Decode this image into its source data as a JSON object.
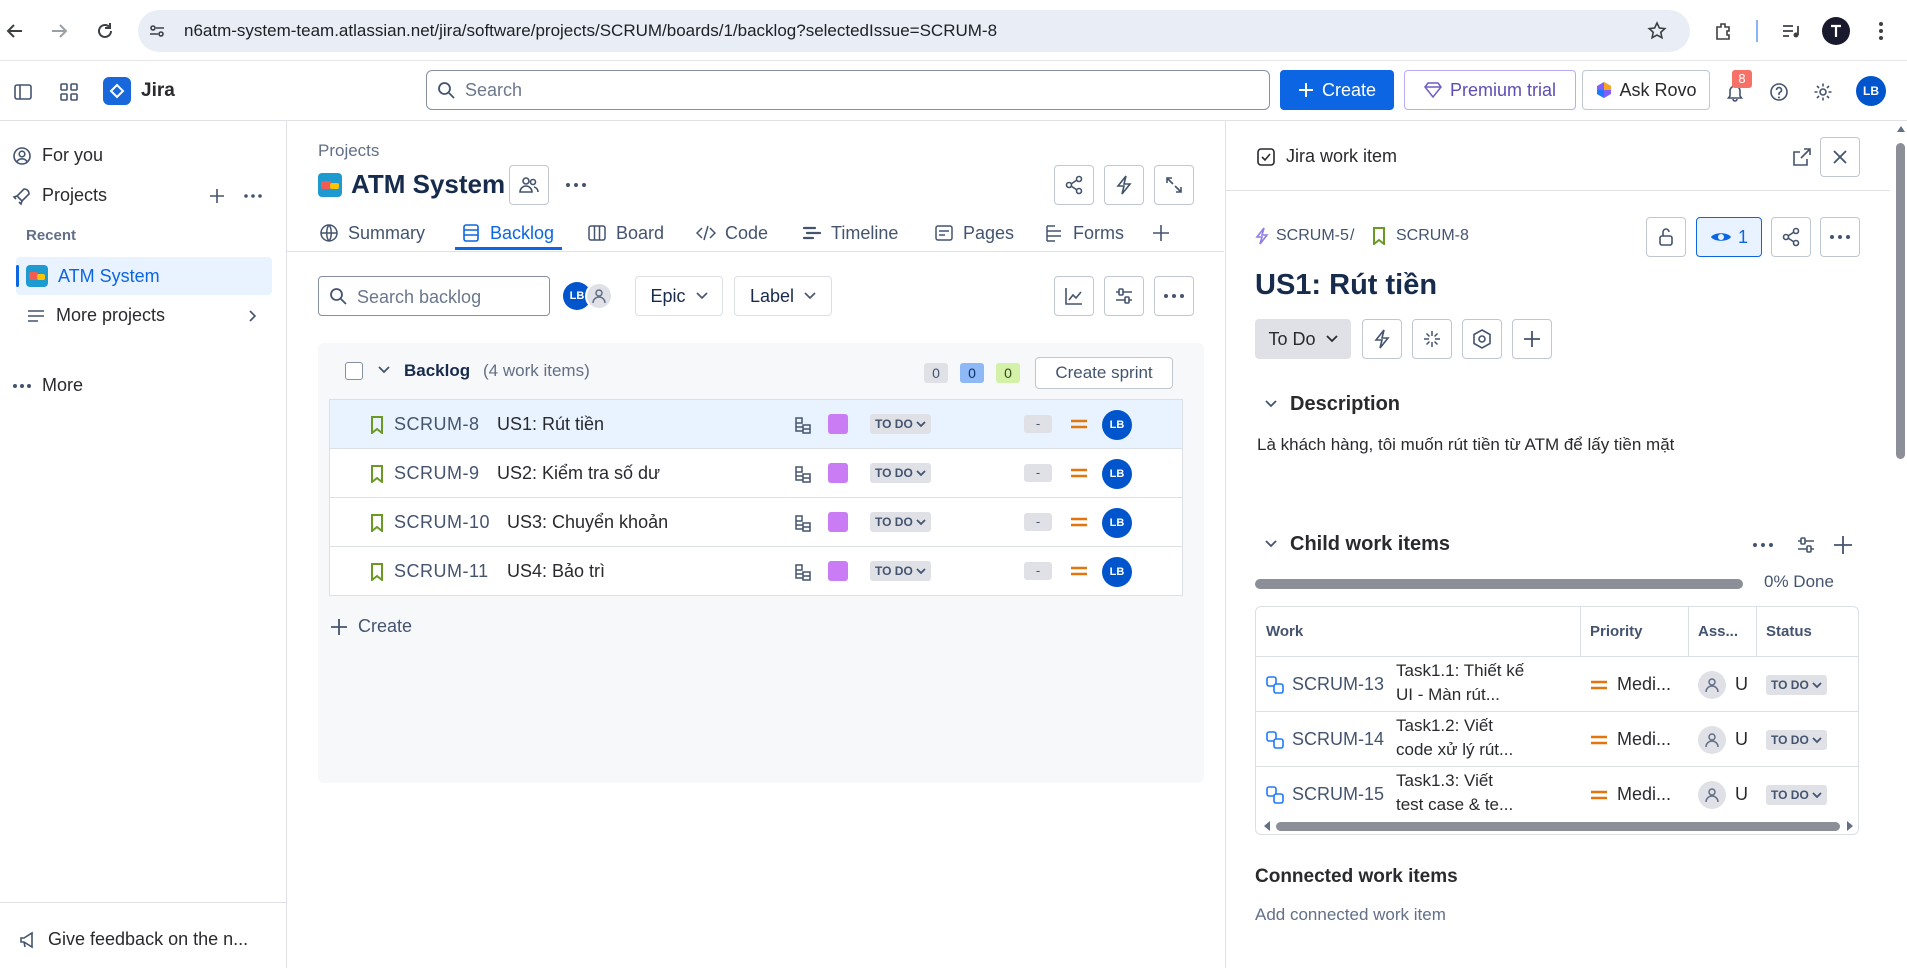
{
  "browser": {
    "url": "n6atm-system-team.atlassian.net/jira/software/projects/SCRUM/boards/1/backlog?selectedIssue=SCRUM-8"
  },
  "topnav": {
    "app_name": "Jira",
    "search_placeholder": "Search",
    "create_label": "Create",
    "premium_label": "Premium trial",
    "rovo_label": "Ask Rovo",
    "notif_count": "8",
    "user_initials": "LB"
  },
  "sidebar": {
    "for_you": "For you",
    "projects": "Projects",
    "recent_heading": "Recent",
    "recent_project": "ATM System",
    "more_projects": "More projects",
    "more": "More",
    "feedback": "Give feedback on the n..."
  },
  "project": {
    "breadcrumb": "Projects",
    "title": "ATM System",
    "tabs": [
      "Summary",
      "Backlog",
      "Board",
      "Code",
      "Timeline",
      "Pages",
      "Forms"
    ]
  },
  "backlog": {
    "search_placeholder": "Search backlog",
    "epic_filter": "Epic",
    "label_filter": "Label",
    "heading": "Backlog",
    "count": "(4 work items)",
    "counts": [
      "0",
      "0",
      "0"
    ],
    "create_sprint": "Create sprint",
    "create_label": "Create",
    "status_label": "TO DO",
    "points": "-",
    "assignee": "LB",
    "items": [
      {
        "key": "SCRUM-8",
        "summary": "US1: Rút tiền"
      },
      {
        "key": "SCRUM-9",
        "summary": "US2: Kiểm tra số dư"
      },
      {
        "key": "SCRUM-10",
        "summary": "US3: Chuyển khoản"
      },
      {
        "key": "SCRUM-11",
        "summary": "US4: Bảo trì"
      }
    ]
  },
  "detail": {
    "header": "Jira work item",
    "parent_key": "SCRUM-5",
    "separator": "/",
    "key": "SCRUM-8",
    "watch_count": "1",
    "title": "US1: Rút tiền",
    "status": "To Do",
    "description_heading": "Description",
    "description": "Là khách hàng, tôi muốn rút tiền từ ATM để lấy tiền mặt",
    "child_heading": "Child work items",
    "progress_label": "0% Done",
    "progress_fraction": 0,
    "columns": [
      "Work",
      "Priority",
      "Ass...",
      "Status"
    ],
    "children": [
      {
        "key": "SCRUM-13",
        "line1": "Task1.1: Thiết kế",
        "line2": "UI - Màn rút...",
        "priority": "Medi...",
        "assignee": "U",
        "status": "TO DO"
      },
      {
        "key": "SCRUM-14",
        "line1": "Task1.2: Viết",
        "line2": "code xử lý rút...",
        "priority": "Medi...",
        "assignee": "U",
        "status": "TO DO"
      },
      {
        "key": "SCRUM-15",
        "line1": "Task1.3: Viết",
        "line2": "test case & te...",
        "priority": "Medi...",
        "assignee": "U",
        "status": "TO DO"
      }
    ],
    "connected_heading": "Connected work items",
    "connected_add": "Add connected work item"
  },
  "colors": {
    "brand_blue": "#0c66e4",
    "epic_purple": "#c97cf4",
    "story_green": "#6a9a23",
    "priority_orange": "#e2760d"
  }
}
